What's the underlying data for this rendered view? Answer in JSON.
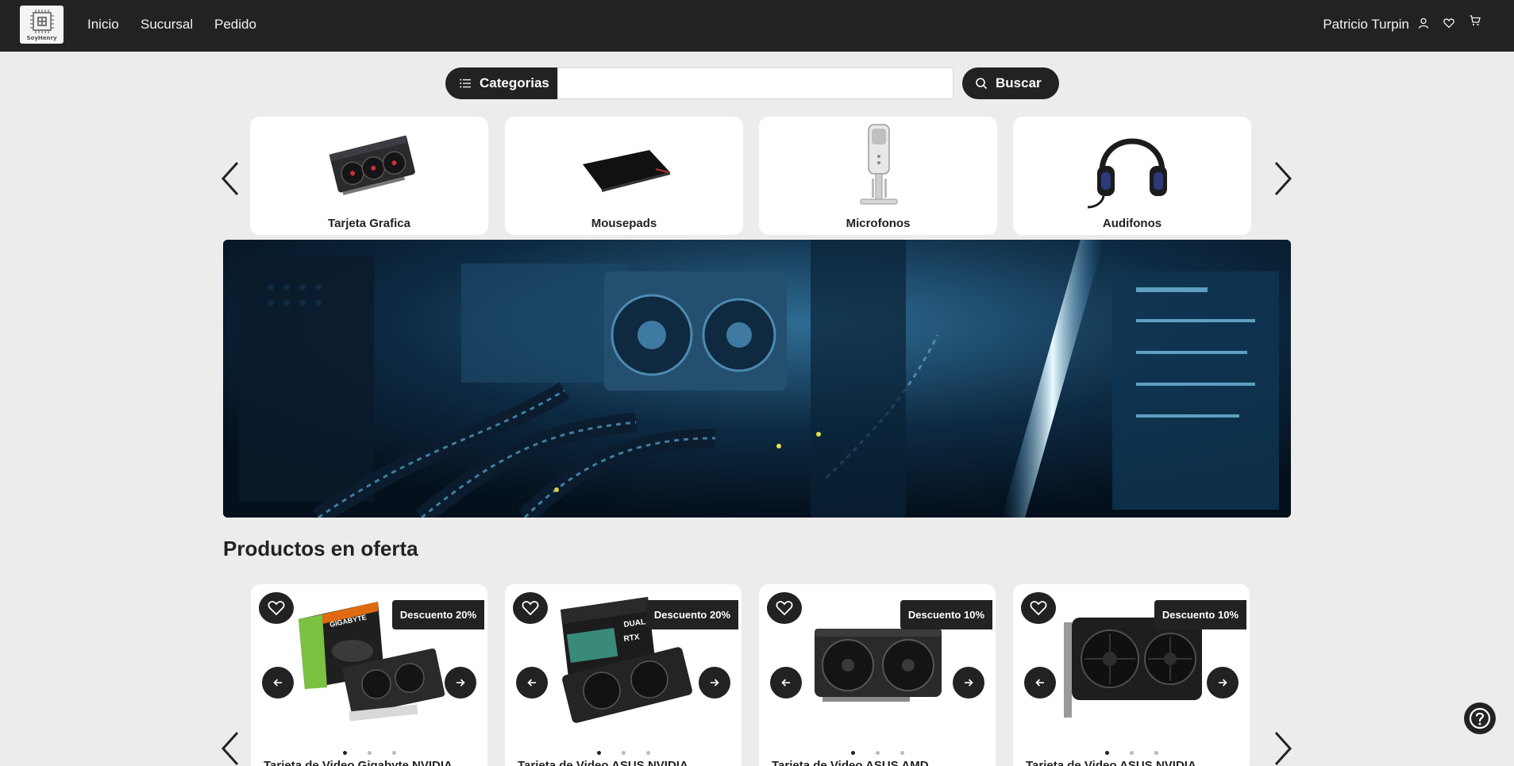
{
  "navbar": {
    "logo_text": "SoyHenry",
    "links": [
      "Inicio",
      "Sucursal",
      "Pedido"
    ],
    "user_name": "Patricio Turpin"
  },
  "search": {
    "categories_label": "Categorias",
    "placeholder": "",
    "value": "",
    "button_label": "Buscar"
  },
  "categories": [
    {
      "label": "Tarjeta Grafica",
      "icon": "graphics-card-image"
    },
    {
      "label": "Mousepads",
      "icon": "mousepad-image"
    },
    {
      "label": "Microfonos",
      "icon": "microphone-image"
    },
    {
      "label": "Audifonos",
      "icon": "headphones-image"
    }
  ],
  "offers": {
    "title": "Productos en oferta",
    "products": [
      {
        "discount": "Descuento 20%",
        "name": "Tarjeta de Video Gigabyte NVIDIA",
        "image": "gigabyte-gpu-box-image"
      },
      {
        "discount": "Descuento 20%",
        "name": "Tarjeta de Video ASUS NVIDIA",
        "image": "asus-dual-rtx-box-image"
      },
      {
        "discount": "Descuento 10%",
        "name": "Tarjeta de Video ASUS AMD",
        "image": "asus-amd-gpu-image"
      },
      {
        "discount": "Descuento 10%",
        "name": "Tarjeta de Video ASUS NVIDIA",
        "image": "asus-nvidia-gpu-image"
      }
    ]
  },
  "colors": {
    "navbar": "#222222",
    "background": "#ececec",
    "card": "#ffffff",
    "accent_dark": "#222222"
  }
}
